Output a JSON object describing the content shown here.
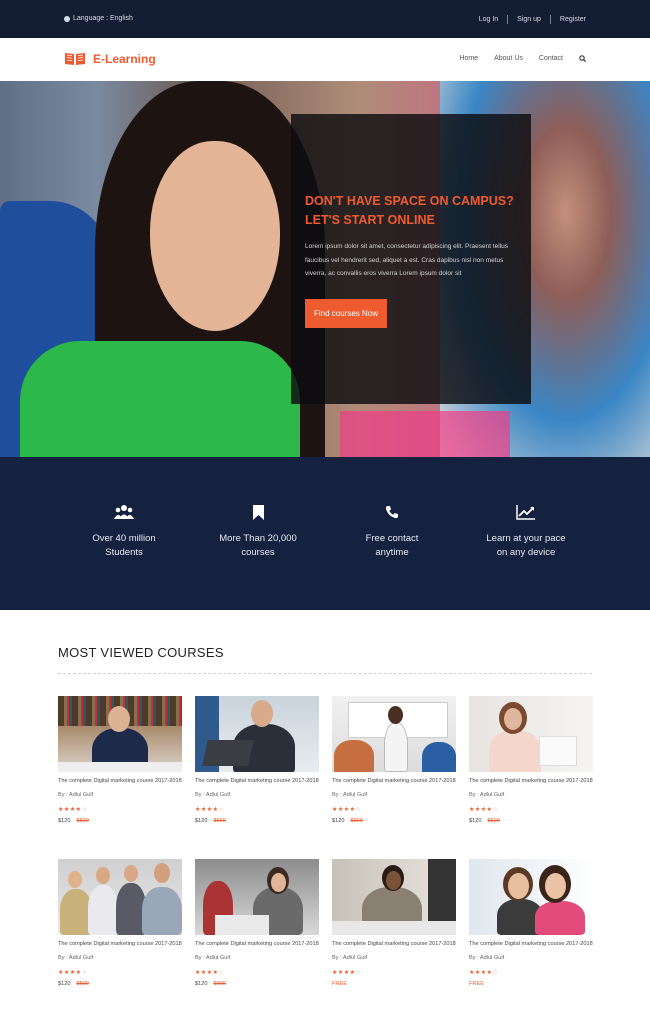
{
  "topbar": {
    "language": "Language : English",
    "links": [
      "Log In",
      "Sign up",
      "Register"
    ]
  },
  "nav": {
    "brand": "E-Learning",
    "items": [
      "Home",
      "About Us",
      "Contact"
    ],
    "search_icon": "search-icon"
  },
  "hero": {
    "title_line1": "DON'T HAVE SPACE ON CAMPUS?",
    "title_line2": "LET'S START ONLINE",
    "text": "Lorem ipsum dolor sit amet, consectetur adipiscing elit. Praesent tellus faucibus vel hendrerit sed, aliquet a est. Cras dapibus nisl non metus viverra, ac convallis eros viverra Lorem ipsum dolor sit",
    "button": "Find courses Now"
  },
  "features": [
    {
      "icon": "users-icon",
      "line1": "Over 40 million",
      "line2": "Students"
    },
    {
      "icon": "bookmark-icon",
      "line1": "More Than 20,000",
      "line2": "courses"
    },
    {
      "icon": "phone-icon",
      "line1": "Free contact",
      "line2": "anytime"
    },
    {
      "icon": "chart-icon",
      "line1": "Learn at your pace",
      "line2": "on any device"
    }
  ],
  "courses": {
    "heading": "MOST VIEWED COURSES",
    "items": [
      {
        "title": "The complete Digital marketing course 2017-2018",
        "author": "By : Adlul Gulf",
        "rating": 4,
        "price": "$120",
        "old_price": "$500"
      },
      {
        "title": "The complete Digital marketing course 2017-2018",
        "author": "By : Adlul Gulf",
        "rating": 4,
        "price": "$120",
        "old_price": "$560"
      },
      {
        "title": "The complete Digital marketing course 2017-2018",
        "author": "By : Adlul Gulf",
        "rating": 4,
        "price": "$120",
        "old_price": "$900"
      },
      {
        "title": "The complete Digital marketing course 2017-2018",
        "author": "By : Adlul Gulf",
        "rating": 4,
        "price": "$120",
        "old_price": "$500"
      },
      {
        "title": "The complete Digital marketing course 2017-2018",
        "author": "By : Adlul Gulf",
        "rating": 4,
        "price": "$120",
        "old_price": "$500"
      },
      {
        "title": "The complete Digital marketing course 2017-2018",
        "author": "By : Adlul Gulf",
        "rating": 4,
        "price": "$120",
        "old_price": "$900"
      },
      {
        "title": "The complete Digital marketing course 2017-2018",
        "author": "By : Adlul Gulf",
        "rating": 4,
        "price": "FREE",
        "old_price": ""
      },
      {
        "title": "The complete Digital marketing course 2017-2018",
        "author": "By : Adlul Gulf",
        "rating": 4,
        "price": "FREE",
        "old_price": ""
      }
    ]
  },
  "colors": {
    "accent": "#ee5b2f",
    "dark_navy": "#131d33",
    "features_bg": "#15223f"
  }
}
